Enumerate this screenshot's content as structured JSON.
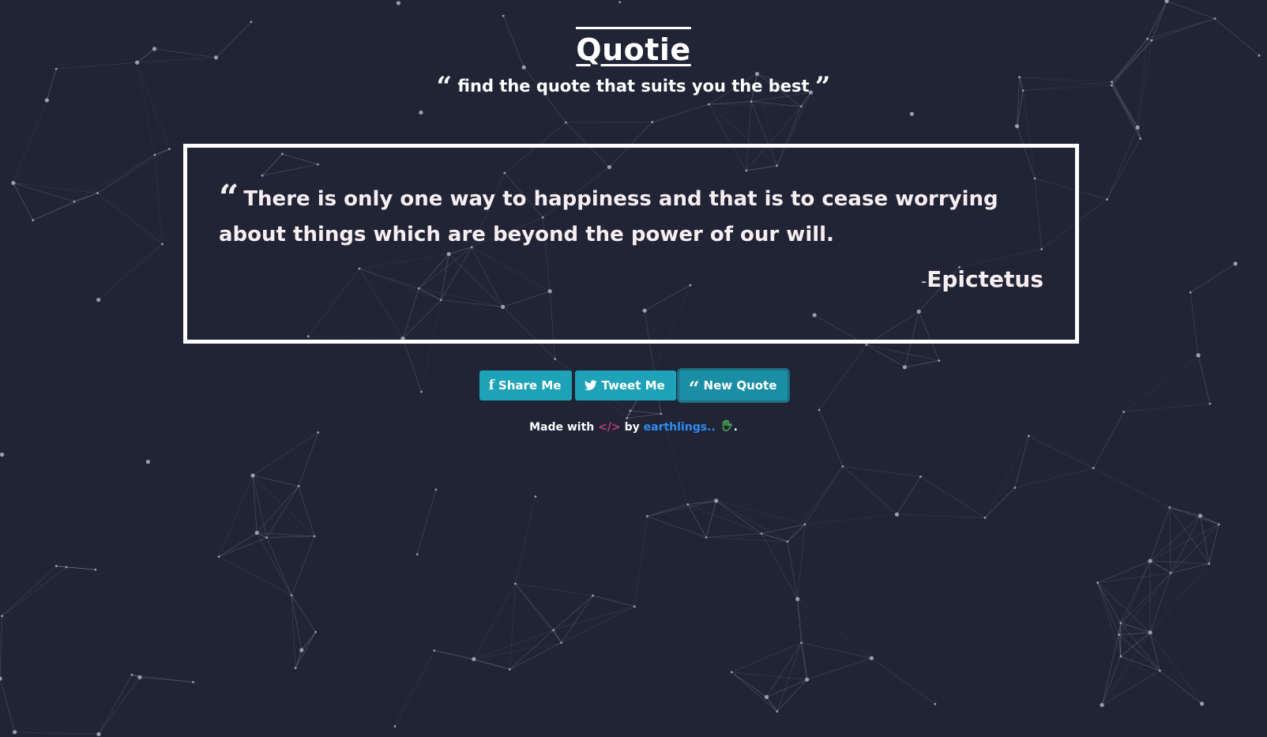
{
  "header": {
    "title": "Quotie",
    "subtitle": "find the quote that suits you the best"
  },
  "quote": {
    "text": "There is only one way to happiness and that is to cease worrying about things which are beyond the power of our will.",
    "author_prefix": "-",
    "author": "Epictetus"
  },
  "buttons": {
    "share": "Share Me",
    "tweet": "Tweet Me",
    "new_quote": "New Quote"
  },
  "footer": {
    "made_with": "Made with",
    "by": "by",
    "author_link": "earthlings..",
    "period": "."
  },
  "icons": {
    "open_quote": "quote-left-icon",
    "close_quote": "quote-right-icon",
    "facebook": "facebook-icon",
    "twitter": "twitter-icon",
    "code": "code-icon",
    "hand": "hand-icon"
  },
  "colors": {
    "background": "#202434",
    "button": "#1da2b7",
    "code_icon": "#c23a7b",
    "link": "#2e8cf2",
    "hand_icon": "#4caf50"
  }
}
